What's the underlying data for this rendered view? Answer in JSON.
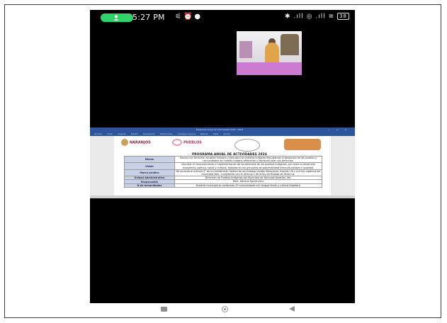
{
  "status_bar": {
    "time": "5:27 PM",
    "left_icons": [
      "notification-icon",
      "alarm-icon",
      "chat-icon"
    ],
    "right_icons": [
      "bluetooth-icon",
      "signal-icon",
      "signal-icon",
      "wifi-icon"
    ],
    "battery": "38",
    "call_pill_color": "#2ed36a"
  },
  "document": {
    "window_title": "Programa Anual de Actividades 2024 - Word",
    "ribbon_tabs": [
      "Archivo",
      "Inicio",
      "Insertar",
      "Diseño",
      "Disposición",
      "Referencias",
      "Correspondencia",
      "Revisar",
      "Vista",
      "Ayuda"
    ],
    "logos": {
      "naranjos": "NARANJOS",
      "naranjos_sub": "AMATLÁN",
      "puebloslr": "PUEBLOS"
    },
    "title": "PROGRAMA ANUAL DE ACTIVIDADES 2024",
    "rows": [
      {
        "label": "Misión",
        "value": "Somos una Dirección sensible humana y ejecutora en materia indígena impulsamos el desarrollo de los pueblos y comunidades de nuestro integral afirmando y haciendo valer sus derechos."
      },
      {
        "label": "Visión",
        "value": "Impulsar el reconocimiento e implementación de los derechos de los pueblos indígenas, así como su desarrollo económico, político, social y cultural, basados en los principios de sostenibilidad interculturalidad e igualdad."
      },
      {
        "label": "Marco Jurídico",
        "value": "De acuerdo al artículo 2° de la Constitución Política de los Estados Unidos Mexicanos, fracción VII y a la ley orgánica del municipio libre, cumpliendo con el artículo 2 de la ley del Estado de Veracruz."
      },
      {
        "label": "Unidad Administrativa",
        "value": "Dirección de Pueblos Indígenas del Municipio de Naranjos Amatlán, Ver."
      },
      {
        "label": "Responsable",
        "value": "Mtra. Adriana Rocha xxxx"
      },
      {
        "label": "N.de Inmunidades",
        "value": "Nuestro municipio lo conforman 25 comunidades con lengua tének y cultura Huasteca"
      }
    ]
  },
  "nav_bar": {
    "buttons": [
      "recents-button",
      "home-button",
      "back-button"
    ]
  }
}
